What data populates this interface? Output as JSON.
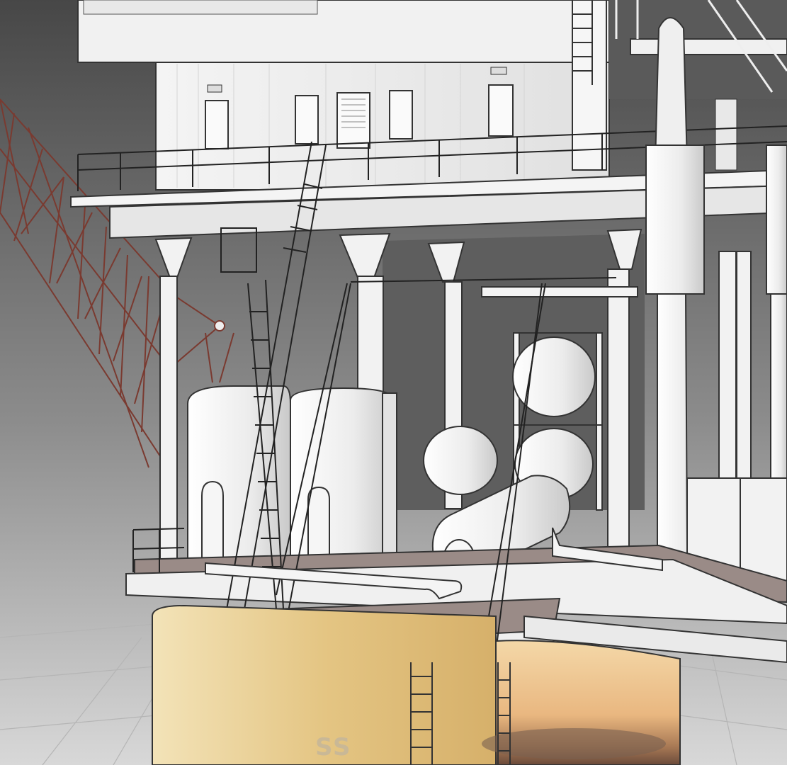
{
  "tank_label": "SS",
  "colors": {
    "background_top": "#4a4a4a",
    "background_bottom": "#cfcfcf",
    "structure": "#f2f2f2",
    "outline": "#2a2a2a",
    "crane": "#7a3a30",
    "tank": "#e6c98a",
    "deck": "#9a8a86"
  }
}
